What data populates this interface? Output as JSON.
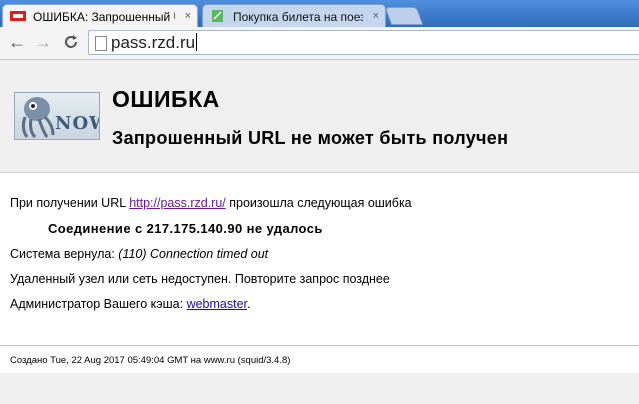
{
  "tabs": [
    {
      "favicon": "rzd-icon",
      "title": "ОШИБКА: Запрошенный URL",
      "close": "×"
    },
    {
      "favicon": "document-icon",
      "title": "Покупка билета на поезд",
      "close": "×"
    }
  ],
  "toolbar": {
    "back": "←",
    "forward": "→",
    "reload": "C",
    "url": "pass.rzd.ru"
  },
  "page": {
    "logo_text": "NOW",
    "title": "ОШИБКА",
    "subtitle": "Запрошенный URL не может быть получен",
    "line1_prefix": "При получении URL ",
    "line1_link": "http://pass.rzd.ru/",
    "line1_suffix": " произошла следующая ошибка",
    "error": "Соединение с 217.175.140.90 не удалось",
    "system_prefix": "Система вернула: ",
    "system_message": "(110) Connection timed out",
    "host_message": "Удаленный узел или сеть недоступен. Повторите запрос позднее",
    "admin_prefix": "Администратор Вашего кэша: ",
    "admin_link": "webmaster",
    "admin_suffix": ".",
    "footer": "Создано Tue, 22 Aug 2017 05:49:04 GMT на www.ru (squid/3.4.8)"
  },
  "colors": {
    "tabstrip": "#3a78c8",
    "link": "#1a0dab",
    "visited_link": "#6a1b9a",
    "header_bg": "#efefef"
  }
}
